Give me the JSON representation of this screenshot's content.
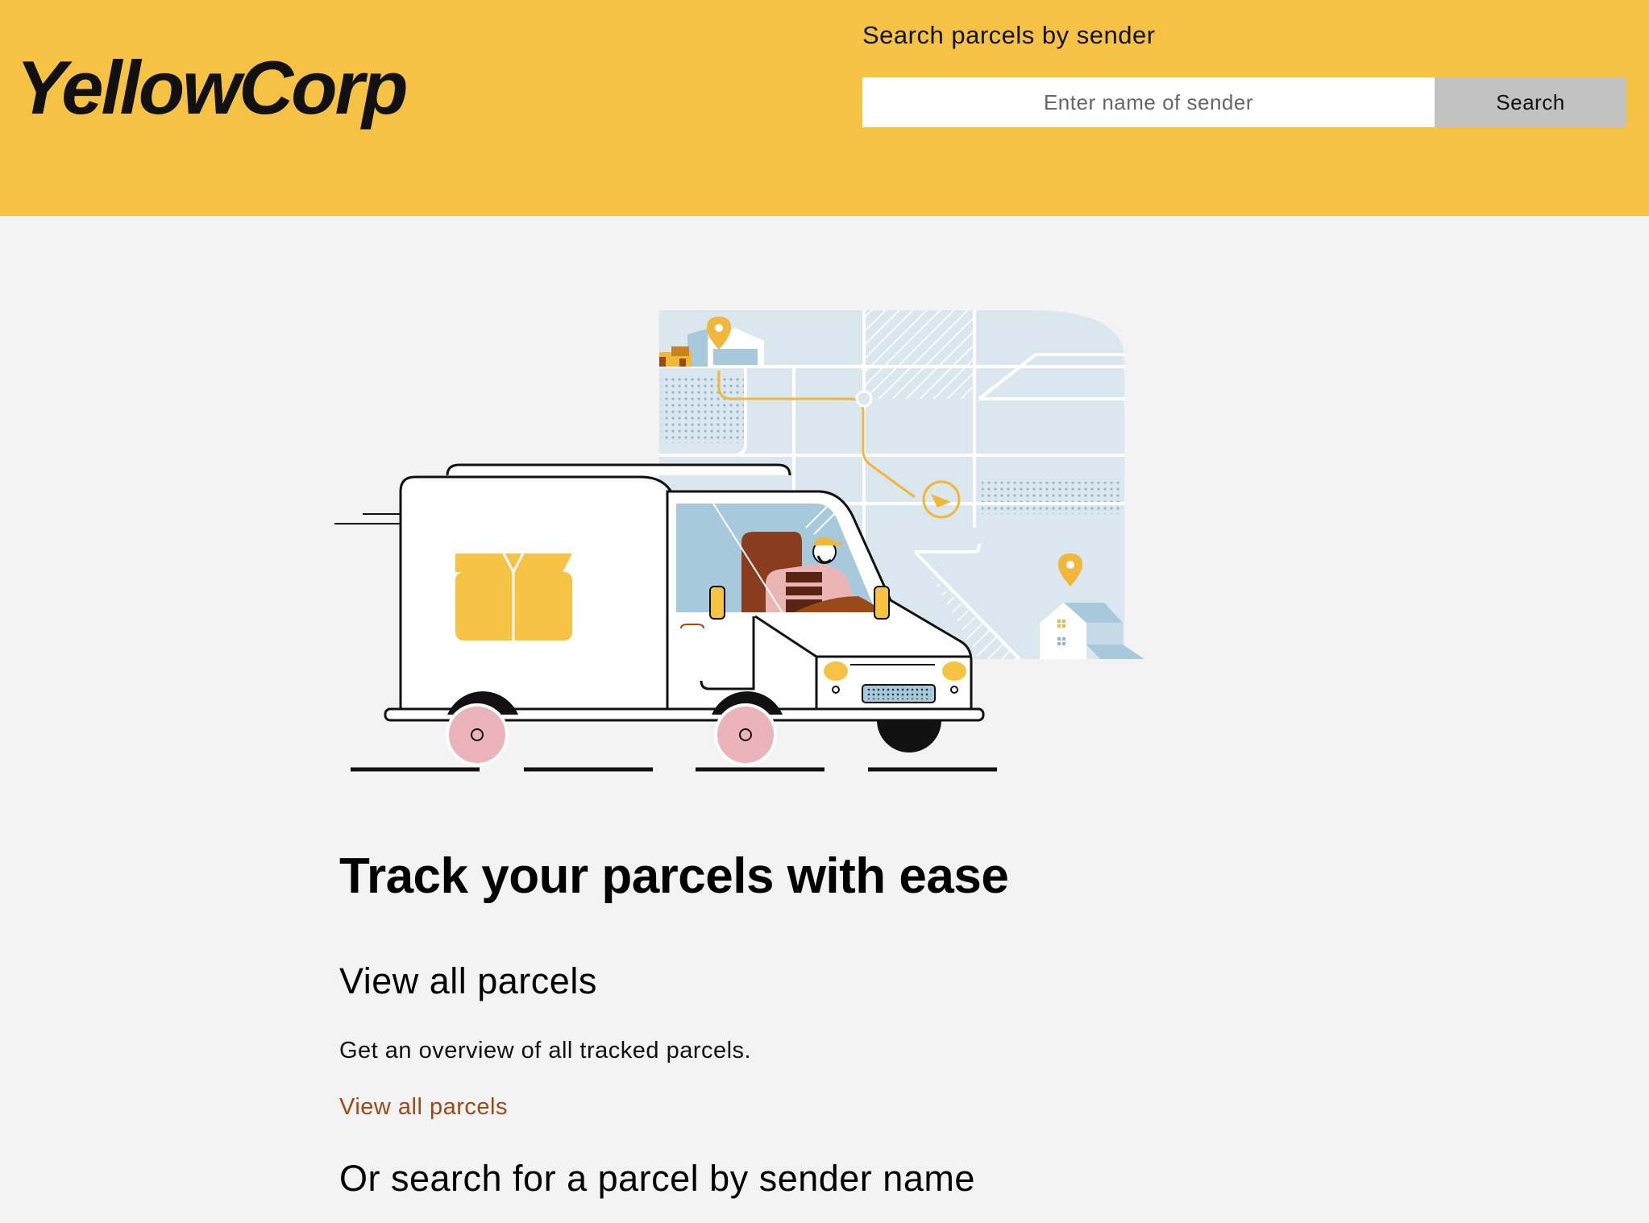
{
  "header": {
    "logo": "YellowCorp",
    "search_label": "Search parcels by sender",
    "search_placeholder": "Enter name of sender",
    "search_button": "Search"
  },
  "main": {
    "title": "Track your parcels with ease",
    "section_heading": "View all parcels",
    "section_text": "Get an overview of all tracked parcels.",
    "section_link": "View all parcels",
    "search_heading": "Or search for a parcel by sender name"
  },
  "colors": {
    "brand_yellow": "#f6c244",
    "background": "#f3f3f3",
    "link": "#9a4a17",
    "button_gray": "#c2c2c2"
  },
  "illustration": {
    "semantic": "delivery-van-with-map-illustration"
  }
}
